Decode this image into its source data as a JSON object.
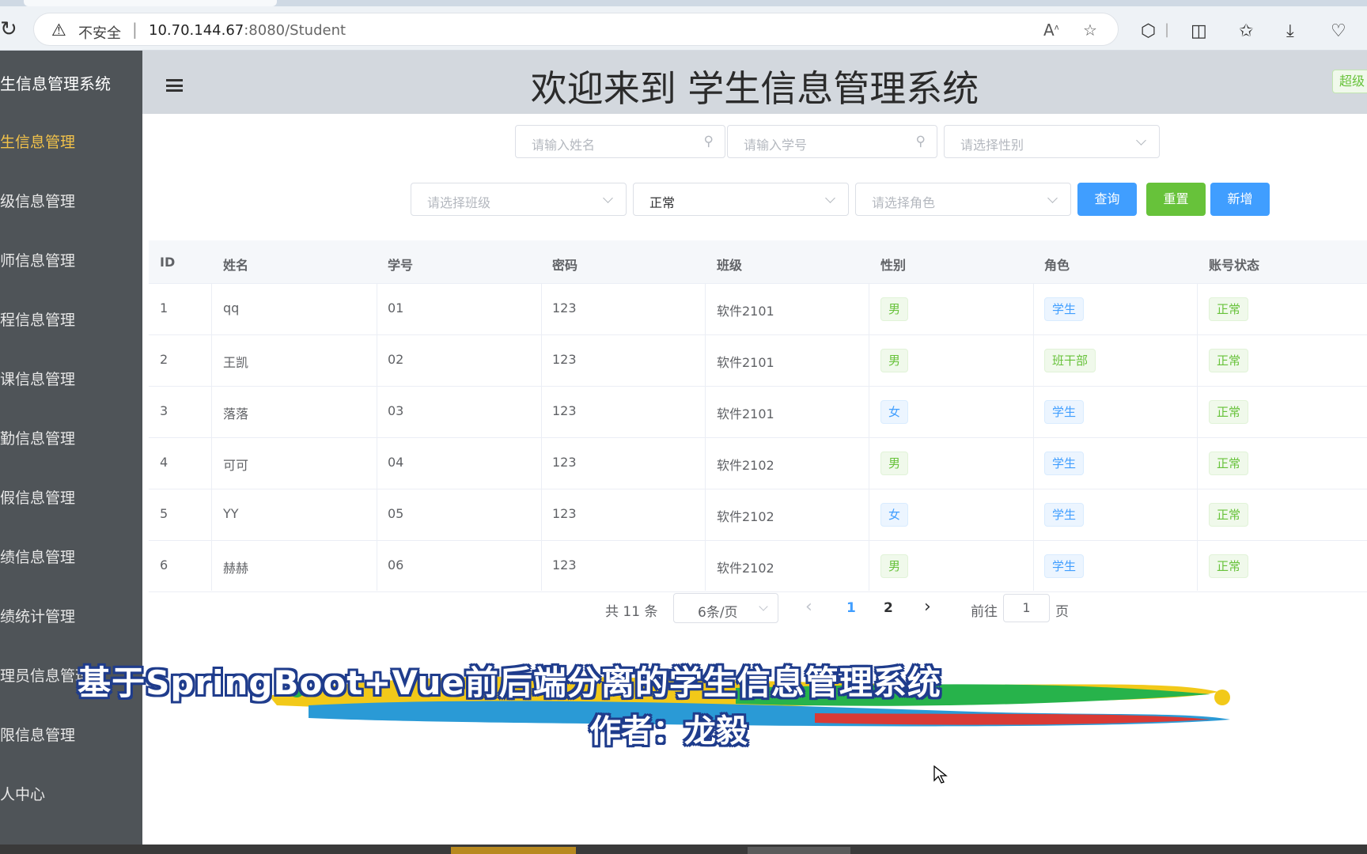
{
  "browser": {
    "insecure_label": "不安全",
    "url_host": "10.70.144.67",
    "url_path": ":8080/Student"
  },
  "sidebar": {
    "title": "生信息管理系统",
    "items": [
      {
        "label": "生信息管理"
      },
      {
        "label": "级信息管理"
      },
      {
        "label": "师信息管理"
      },
      {
        "label": "程信息管理"
      },
      {
        "label": "课信息管理"
      },
      {
        "label": "勤信息管理"
      },
      {
        "label": "假信息管理"
      },
      {
        "label": "绩信息管理"
      },
      {
        "label": "绩统计管理"
      },
      {
        "label": "理员信息管理"
      },
      {
        "label": "限信息管理"
      },
      {
        "label": "人中心"
      }
    ]
  },
  "header": {
    "title": "欢迎来到 学生信息管理系统",
    "role_tag": "超级"
  },
  "filters": {
    "name_placeholder": "请输入姓名",
    "number_placeholder": "请输入学号",
    "gender_placeholder": "请选择性别",
    "class_placeholder": "请选择班级",
    "status_value": "正常",
    "role_placeholder": "请选择角色",
    "query_label": "查询",
    "reset_label": "重置",
    "add_label": "新增"
  },
  "table": {
    "columns": [
      "ID",
      "姓名",
      "学号",
      "密码",
      "班级",
      "性别",
      "角色",
      "账号状态"
    ],
    "rows": [
      {
        "id": "1",
        "name": "qq",
        "number": "01",
        "password": "123",
        "class": "软件2101",
        "gender": "男",
        "role": "学生",
        "status": "正常"
      },
      {
        "id": "2",
        "name": "王凯",
        "number": "02",
        "password": "123",
        "class": "软件2101",
        "gender": "男",
        "role": "班干部",
        "status": "正常"
      },
      {
        "id": "3",
        "name": "落落",
        "number": "03",
        "password": "123",
        "class": "软件2101",
        "gender": "女",
        "role": "学生",
        "status": "正常"
      },
      {
        "id": "4",
        "name": "可可",
        "number": "04",
        "password": "123",
        "class": "软件2102",
        "gender": "男",
        "role": "学生",
        "status": "正常"
      },
      {
        "id": "5",
        "name": "YY",
        "number": "05",
        "password": "123",
        "class": "软件2102",
        "gender": "女",
        "role": "学生",
        "status": "正常"
      },
      {
        "id": "6",
        "name": "赫赫",
        "number": "06",
        "password": "123",
        "class": "软件2102",
        "gender": "男",
        "role": "学生",
        "status": "正常"
      }
    ]
  },
  "pagination": {
    "total": "共 11 条",
    "page_size": "6条/页",
    "pages": [
      "1",
      "2"
    ],
    "current_page": "1",
    "goto_label": "前往",
    "goto_value": "1",
    "page_suffix": "页"
  },
  "banner": {
    "title": "基于SpringBoot+Vue前后端分离的学生信息管理系统",
    "author": "作者：龙毅"
  },
  "colors": {
    "sidebar_bg": "#4f5458",
    "sidebar_active": "#f2c24a",
    "header_bg": "#d3d8de",
    "primary": "#409eff",
    "success": "#67c23a"
  }
}
